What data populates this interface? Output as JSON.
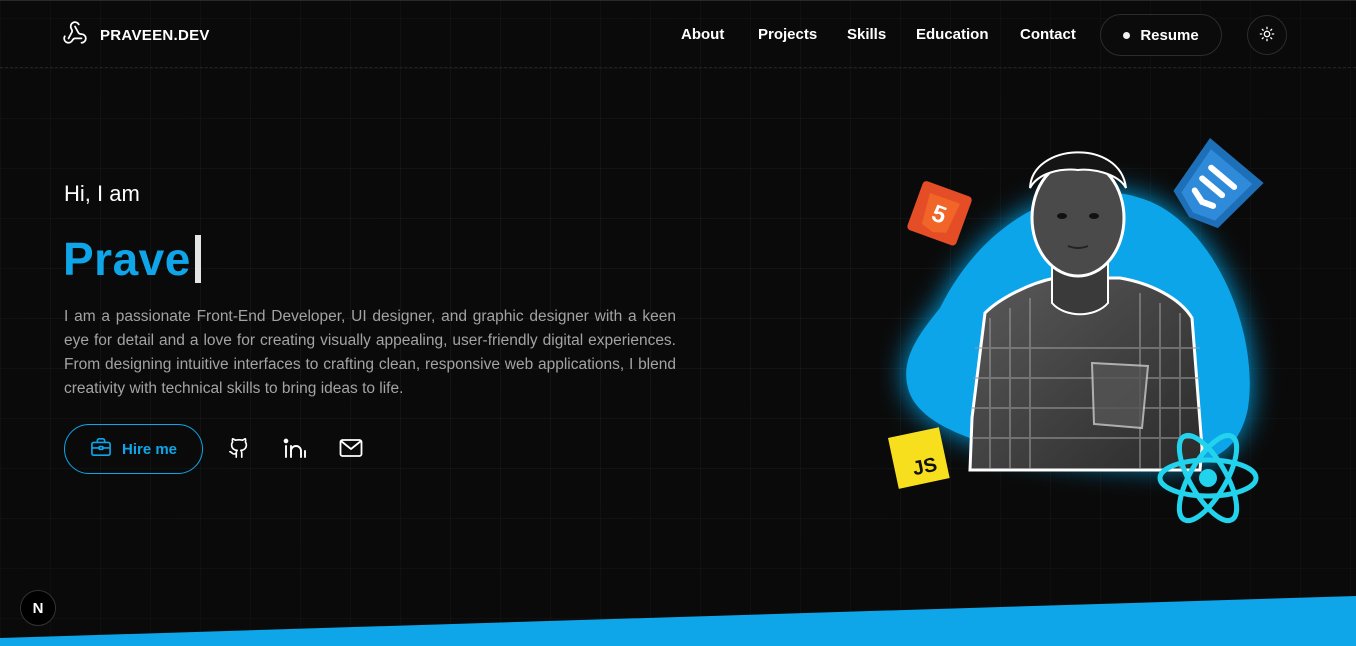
{
  "header": {
    "brand": "PRAVEEN.DEV",
    "nav": [
      "About",
      "Projects",
      "Skills",
      "Education",
      "Contact"
    ],
    "resume_label": "Resume"
  },
  "hero": {
    "greeting": "Hi, I am",
    "name_typed": "Prave",
    "description": "I am a passionate Front-End Developer, UI designer, and graphic designer with a keen eye for detail and a love for creating visually appealing, user-friendly digital experiences. From designing intuitive interfaces to crafting clean, responsive web applications, I blend creativity with technical skills to bring ideas to life.",
    "hire_label": "Hire me",
    "badges": {
      "html": "5",
      "js": "JS"
    }
  },
  "footer": {
    "framework_badge": "N"
  },
  "colors": {
    "accent": "#0ea5e9",
    "background": "#0a0a0a",
    "html5": "#e44d26",
    "js": "#f7df1e"
  },
  "icons": [
    "logo-icon",
    "sun-icon",
    "briefcase-icon",
    "github-icon",
    "linkedin-icon",
    "mail-icon",
    "html5-icon",
    "css-icon",
    "js-icon",
    "react-icon"
  ]
}
